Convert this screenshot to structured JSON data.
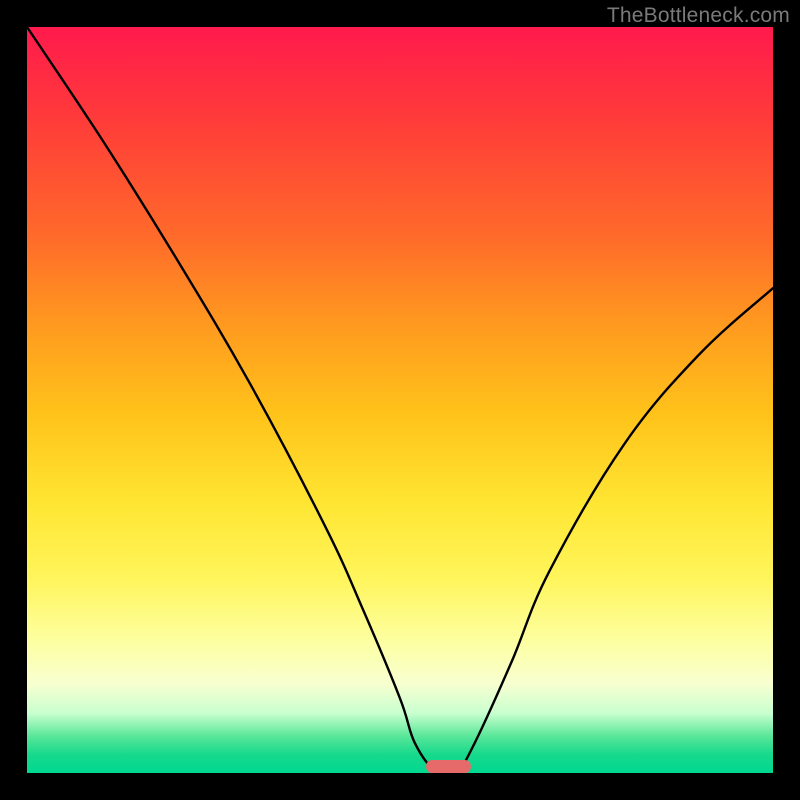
{
  "watermark": {
    "text": "TheBottleneck.com"
  },
  "chart_data": {
    "type": "line",
    "title": "",
    "xlabel": "",
    "ylabel": "",
    "xlim": [
      0,
      100
    ],
    "ylim": [
      0,
      100
    ],
    "grid": false,
    "legend": null,
    "series": [
      {
        "name": "bottleneck-curve",
        "x": [
          0,
          10,
          20,
          30,
          40,
          45,
          50,
          52,
          55,
          57.5,
          60,
          65,
          70,
          80,
          90,
          100
        ],
        "y": [
          100,
          85,
          69,
          52,
          33,
          22,
          10,
          4,
          0,
          0,
          4,
          15,
          27,
          44,
          56,
          65
        ]
      }
    ],
    "marker": {
      "name": "optimal-range",
      "x_center": 56.5,
      "width": 6,
      "y": 0,
      "color": "#e66a6a"
    },
    "background_gradient": {
      "orientation": "vertical",
      "stops": [
        {
          "pos": 0.0,
          "color": "#ff1a4d"
        },
        {
          "pos": 0.5,
          "color": "#ffd21f"
        },
        {
          "pos": 0.85,
          "color": "#fbffc0"
        },
        {
          "pos": 1.0,
          "color": "#00d890"
        }
      ]
    }
  }
}
